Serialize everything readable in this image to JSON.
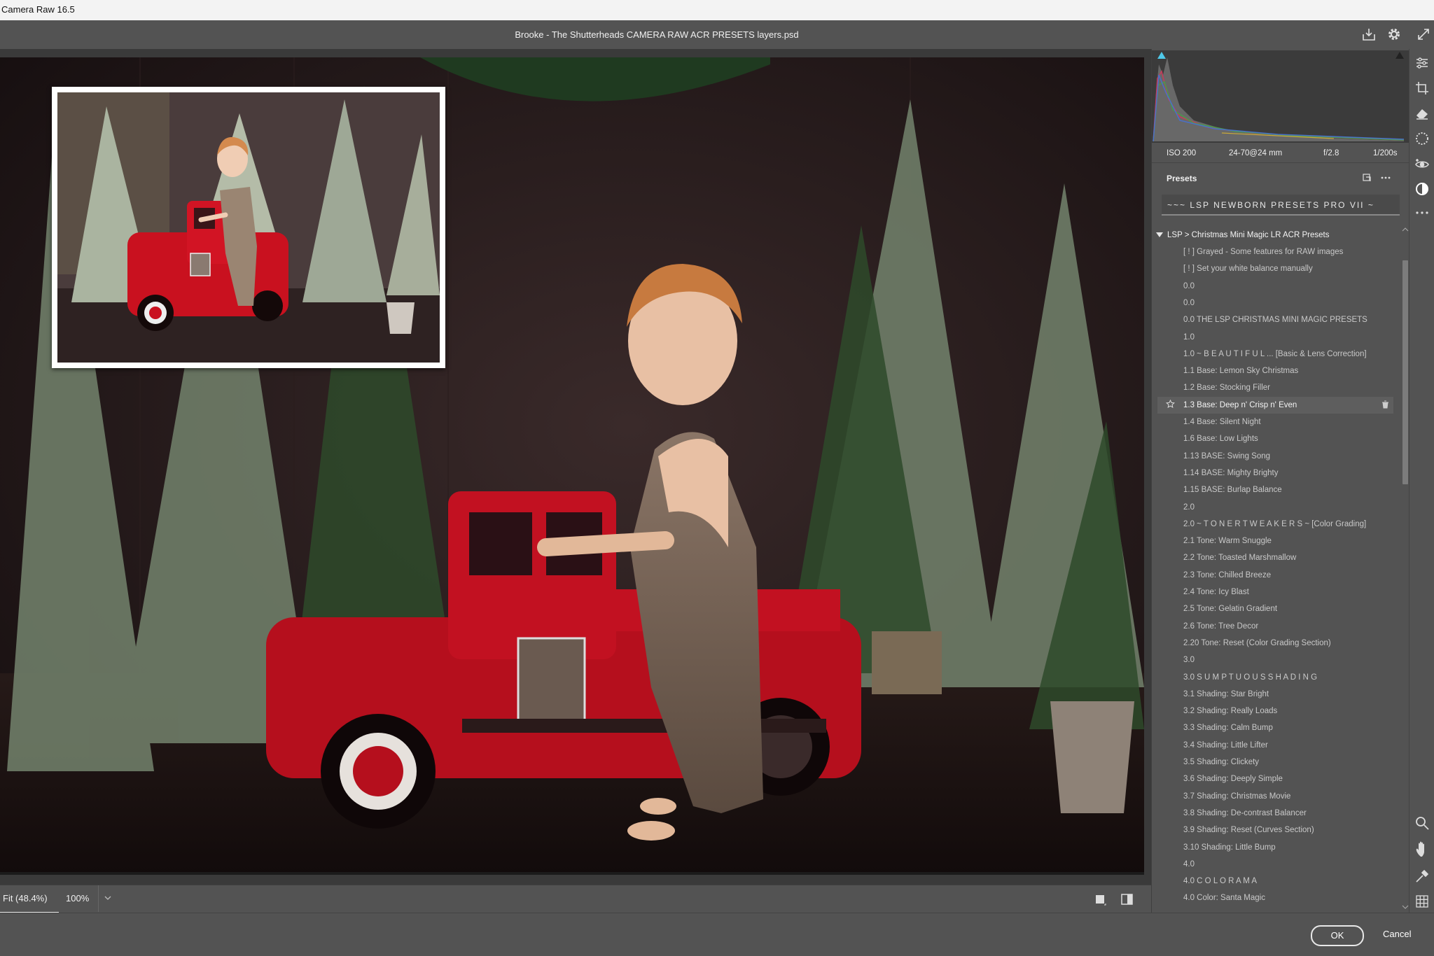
{
  "os": {
    "title": "Camera Raw 16.5"
  },
  "header": {
    "doc_title": "Brooke - The Shutterheads CAMERA RAW ACR PRESETS layers.psd"
  },
  "exif": {
    "iso": "ISO 200",
    "lens": "24-70@24 mm",
    "aperture": "f/2.8",
    "shutter": "1/200s"
  },
  "presets": {
    "title": "Presets",
    "collection": "~~~ LSP NEWBORN PRESETS PRO VII ~",
    "group_label": "LSP > Christmas Mini Magic LR ACR Presets",
    "items": [
      "[ ! ] Grayed - Some features for RAW images",
      "[ ! ] Set your white balance manually",
      "0.0",
      "0.0",
      "0.0  THE LSP CHRISTMAS MINI MAGIC PRESETS",
      "1.0",
      "1.0  ~ B E A U T I F U L    ... [Basic & Lens Correction]",
      "1.1  Base:  Lemon Sky Christmas",
      "1.2  Base:  Stocking Filler",
      "1.3  Base:  Deep n' Crisp n' Even",
      "1.4  Base:  Silent Night",
      "1.6  Base:  Low Lights",
      "1.13 BASE:  Swing Song",
      "1.14 BASE:  Mighty Brighty",
      "1.15 BASE:  Burlap Balance",
      "2.0",
      "2.0  ~ T O N E R   T W E A K E R S ~ [Color Grading]",
      "2.1  Tone: Warm Snuggle",
      "2.2  Tone: Toasted Marshmallow",
      "2.3  Tone: Chilled Breeze",
      "2.4  Tone: Icy Blast",
      "2.5  Tone: Gelatin Gradient",
      "2.6  Tone: Tree Decor",
      "2.20 Tone: Reset (Color Grading Section)",
      "3.0",
      "3.0  S U M P T U O U S   S H A D I N G",
      "3.1  Shading:  Star Bright",
      "3.2  Shading:  Really Loads",
      "3.3  Shading:  Calm Bump",
      "3.4  Shading:  Little Lifter",
      "3.5  Shading:  Clickety",
      "3.6  Shading:  Deeply Simple",
      "3.7  Shading:  Christmas Movie",
      "3.8  Shading: De-contrast Balancer",
      "3.9  Shading:  Reset (Curves Section)",
      "3.10 Shading:  Little Bump",
      "4.0",
      "4.0  C O L O R A M A",
      "4.0  Color: Santa Magic"
    ],
    "selected_index": 9
  },
  "zoom": {
    "fit_label": "Fit (48.4%)",
    "pct_label": "100%"
  },
  "footer": {
    "ok": "OK",
    "cancel": "Cancel"
  },
  "colors": {
    "panel_bg": "#535353",
    "canvas_bg": "#3a3a3a",
    "truck_red": "#c01020"
  }
}
